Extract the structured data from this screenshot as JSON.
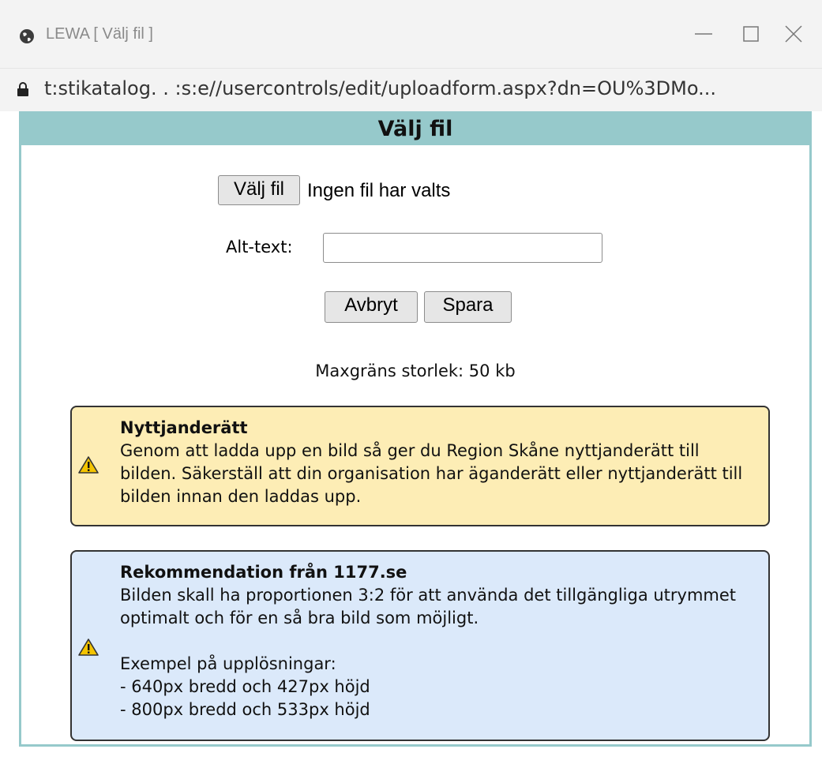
{
  "window": {
    "title": "LEWA [ Välj fil ]",
    "url": "t:stikatalog.  .  :s:e//usercontrols/edit/uploadform.aspx?dn=OU%3DMo..."
  },
  "dialog": {
    "header": "Välj fil",
    "file_button_label": "Välj fil",
    "file_status": "Ingen fil har valts",
    "alt_label": "Alt-text:",
    "alt_value": "",
    "cancel_label": "Avbryt",
    "save_label": "Spara",
    "max_size_text": "Maxgräns storlek: 50 kb"
  },
  "notices": {
    "usage": {
      "title": "Nyttjanderätt",
      "text": "Genom att ladda upp en bild så ger du Region Skåne nyttjanderätt till bilden. Säkerställ att din organisation har äganderätt eller nyttjanderätt till bilden innan den laddas upp.",
      "icon": "warning-icon",
      "color": "#fdedb5"
    },
    "recommendation": {
      "title": "Rekommendation från 1177.se",
      "text": "Bilden skall ha proportionen 3:2 för att använda det tillgängliga utrymmet optimalt och för en så bra bild som möjligt.",
      "examples_label": "Exempel på upplösningar:",
      "examples": [
        "- 640px bredd och 427px höjd",
        "- 800px bredd och 533px höjd"
      ],
      "icon": "warning-icon",
      "color": "#dbe9fa"
    }
  },
  "colors": {
    "accent": "#96c9cb"
  }
}
